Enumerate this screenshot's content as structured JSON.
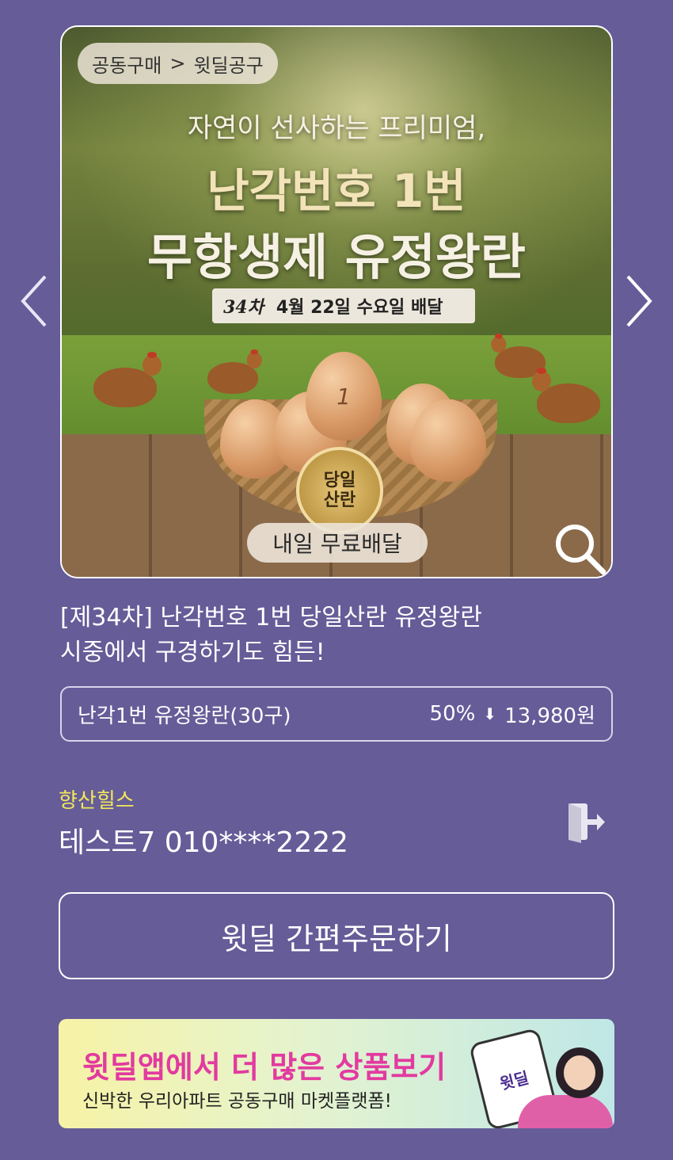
{
  "hero": {
    "breadcrumb_category": "공동구매",
    "breadcrumb_separator": ">",
    "breadcrumb_current": "윗딜공구",
    "subtitle": "자연이 선사하는 프리미엄,",
    "title_line1": "난각번호 1번",
    "title_line2": "무항생제 유정왕란",
    "round_label": "34차",
    "delivery_date": "4월 22일 수요일 배달",
    "badge_line1": "당일",
    "badge_line2": "산란",
    "egg_number": "1",
    "free_shipping": "내일 무료배달"
  },
  "product": {
    "title_line1": "[제34차] 난각번호 1번 당일산란 유정왕란",
    "title_line2": "시중에서 구경하기도 힘든!"
  },
  "option": {
    "name": "난각1번 유정왕란(30구)",
    "discount": "50%",
    "discount_arrow": "⬇",
    "price": "13,980원"
  },
  "user": {
    "complex": "향산힐스",
    "info": "테스트7 010****2222"
  },
  "order_button": "윗딜 간편주문하기",
  "banner": {
    "title": "윗딜앱에서 더 많은 상품보기",
    "subtitle": "신박한 우리아파트 공동구매 마켓플랫폼!",
    "phone_logo": "윗딜"
  },
  "colors": {
    "background": "#655c98",
    "complex_text": "#f3e75a",
    "banner_title": "#e23aa0"
  },
  "icons": {
    "prev": "chevron-left-icon",
    "next": "chevron-right-icon",
    "zoom": "magnifier-icon",
    "logout": "logout-door-icon"
  }
}
